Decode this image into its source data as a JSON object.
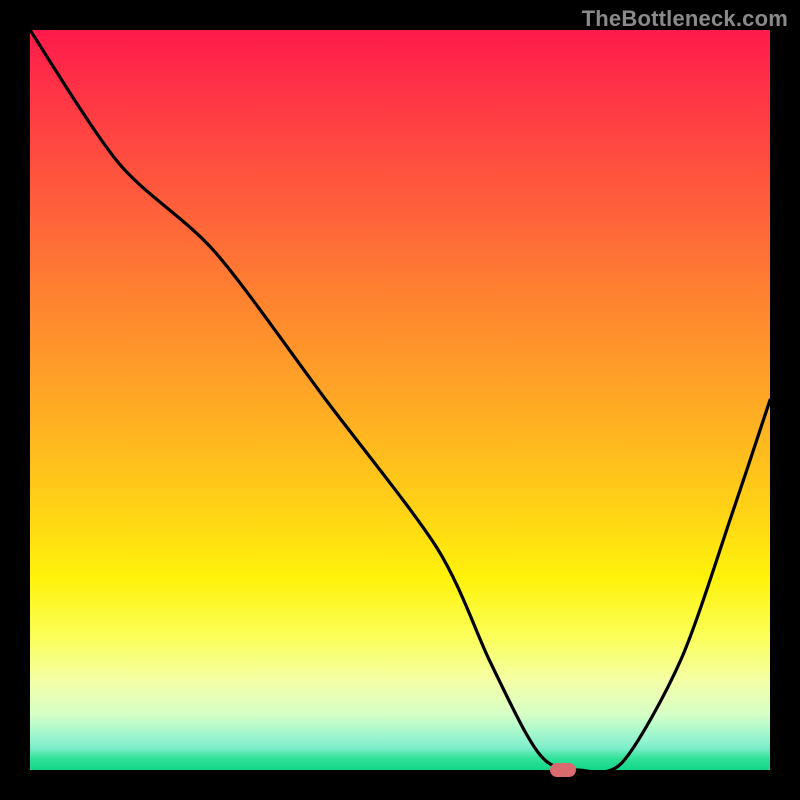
{
  "attribution": "TheBottleneck.com",
  "chart_data": {
    "type": "line",
    "title": "",
    "xlabel": "",
    "ylabel": "",
    "xlim": [
      0,
      100
    ],
    "ylim": [
      0,
      100
    ],
    "x": [
      0,
      12,
      25,
      40,
      55,
      62,
      67,
      70,
      74,
      80,
      88,
      95,
      100
    ],
    "values": [
      100,
      82,
      70,
      50,
      30,
      15,
      5,
      1,
      0,
      1,
      15,
      35,
      50
    ],
    "marker": {
      "x": 72,
      "y": 0
    },
    "gradient_stops": [
      {
        "pos": 0,
        "color": "#ff1a4b"
      },
      {
        "pos": 8,
        "color": "#ff3346"
      },
      {
        "pos": 22,
        "color": "#ff5a3d"
      },
      {
        "pos": 36,
        "color": "#ff8230"
      },
      {
        "pos": 50,
        "color": "#ffa825"
      },
      {
        "pos": 64,
        "color": "#ffd017"
      },
      {
        "pos": 74,
        "color": "#fff20a"
      },
      {
        "pos": 82,
        "color": "#fbff59"
      },
      {
        "pos": 88,
        "color": "#f4ffa8"
      },
      {
        "pos": 92.5,
        "color": "#d6ffc6"
      },
      {
        "pos": 95,
        "color": "#a4f7cc"
      },
      {
        "pos": 97,
        "color": "#7feecb"
      },
      {
        "pos": 98.4,
        "color": "#32e29a"
      },
      {
        "pos": 100,
        "color": "#11d788"
      }
    ],
    "marker_color": "#d96a6e"
  }
}
